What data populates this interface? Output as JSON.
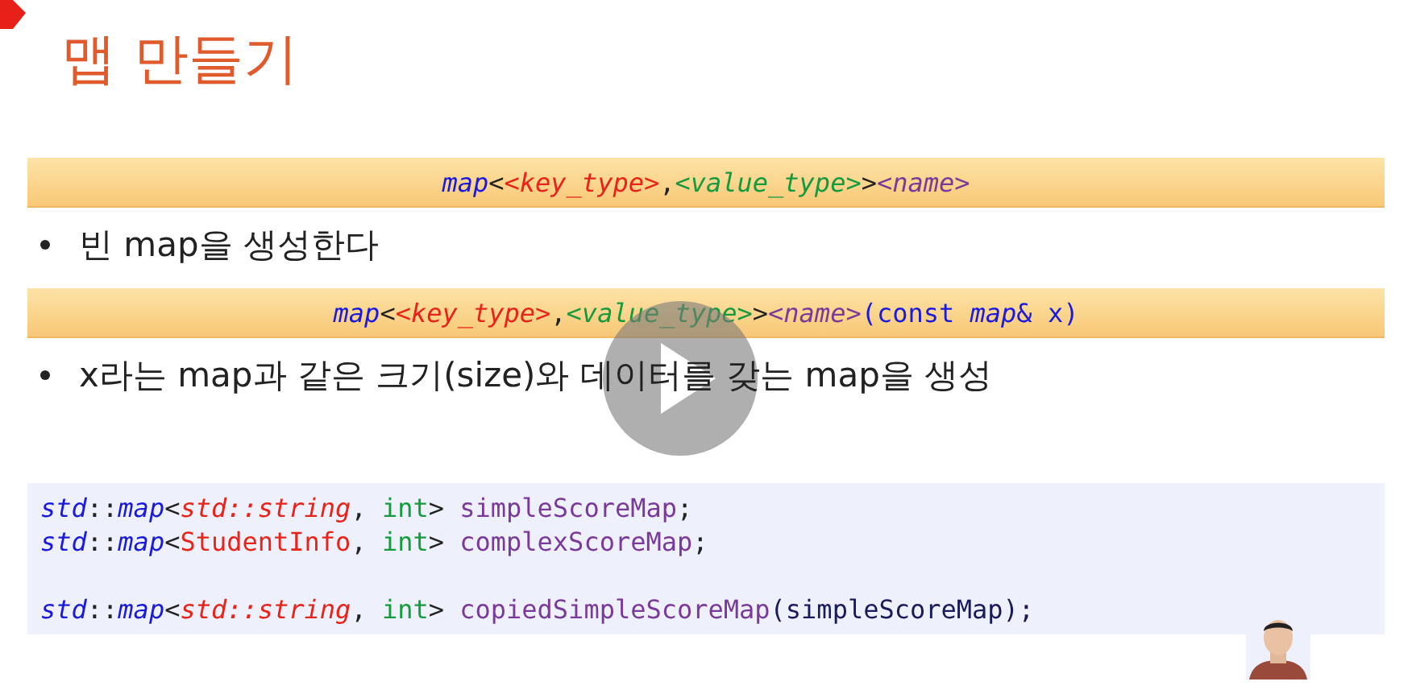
{
  "slide": {
    "title": "맵 만들기",
    "blocks": [
      {
        "kind": "syntax",
        "tokens": [
          {
            "text": "map",
            "color": "#1a1adc",
            "italic": true
          },
          {
            "text": "<",
            "color": "#222222"
          },
          {
            "text": "<key_type>",
            "color": "#e8231a",
            "italic": true
          },
          {
            "text": ",",
            "color": "#222222"
          },
          {
            "text": "<value_type>",
            "color": "#159a3e",
            "italic": true
          },
          {
            "text": ">",
            "color": "#222222"
          },
          {
            "text": "<name>",
            "color": "#7a3a9a",
            "italic": true
          }
        ]
      },
      {
        "kind": "bullet",
        "text": "빈 map을 생성한다"
      },
      {
        "kind": "syntax",
        "tokens": [
          {
            "text": "map",
            "color": "#1a1adc",
            "italic": true
          },
          {
            "text": "<",
            "color": "#222222"
          },
          {
            "text": "<key_type>",
            "color": "#e8231a",
            "italic": true
          },
          {
            "text": ",",
            "color": "#222222"
          },
          {
            "text": "<value_type>",
            "color": "#159a3e",
            "italic": true
          },
          {
            "text": ">",
            "color": "#222222"
          },
          {
            "text": "<name>",
            "color": "#7a3a9a",
            "italic": true
          },
          {
            "text": "(const ",
            "color": "#1a1adc",
            "italic": false
          },
          {
            "text": "map",
            "color": "#1a1adc",
            "italic": true
          },
          {
            "text": "& x)",
            "color": "#1a1adc",
            "italic": false
          }
        ]
      },
      {
        "kind": "bullet",
        "text": "x라는 map과 같은 크기(size)와 데이터를 갖는 map을 생성"
      }
    ],
    "code": [
      {
        "kind": "code",
        "tokens": [
          {
            "text": "std",
            "color": "#1a1adc",
            "italic": true
          },
          {
            "text": "::",
            "color": "#222222"
          },
          {
            "text": "map",
            "color": "#1a1adc",
            "italic": true
          },
          {
            "text": "<",
            "color": "#222222"
          },
          {
            "text": "std::string",
            "color": "#e8231a",
            "italic": true
          },
          {
            "text": ", ",
            "color": "#222222"
          },
          {
            "text": "int",
            "color": "#159a3e",
            "italic": false
          },
          {
            "text": "> ",
            "color": "#222222"
          },
          {
            "text": "simpleScoreMap",
            "color": "#7a3a9a",
            "italic": false
          },
          {
            "text": ";",
            "color": "#222222"
          }
        ]
      },
      {
        "kind": "code",
        "tokens": [
          {
            "text": "std",
            "color": "#1a1adc",
            "italic": true
          },
          {
            "text": "::",
            "color": "#222222"
          },
          {
            "text": "map",
            "color": "#1a1adc",
            "italic": true
          },
          {
            "text": "<",
            "color": "#222222"
          },
          {
            "text": "StudentInfo",
            "color": "#e8231a",
            "italic": false
          },
          {
            "text": ", ",
            "color": "#222222"
          },
          {
            "text": "int",
            "color": "#159a3e",
            "italic": false
          },
          {
            "text": "> ",
            "color": "#222222"
          },
          {
            "text": "complexScoreMap",
            "color": "#7a3a9a",
            "italic": false
          },
          {
            "text": ";",
            "color": "#222222"
          }
        ]
      },
      {
        "kind": "blank"
      },
      {
        "kind": "code",
        "tokens": [
          {
            "text": "std",
            "color": "#1a1adc",
            "italic": true
          },
          {
            "text": "::",
            "color": "#222222"
          },
          {
            "text": "map",
            "color": "#1a1adc",
            "italic": true
          },
          {
            "text": "<",
            "color": "#222222"
          },
          {
            "text": "std::string",
            "color": "#e8231a",
            "italic": true
          },
          {
            "text": ", ",
            "color": "#222222"
          },
          {
            "text": "int",
            "color": "#159a3e",
            "italic": false
          },
          {
            "text": "> ",
            "color": "#222222"
          },
          {
            "text": "copiedSimpleScoreMap",
            "color": "#7a3a9a",
            "italic": false
          },
          {
            "text": "(simpleScoreMap);",
            "color": "#1a1a5a",
            "italic": false
          }
        ]
      }
    ]
  }
}
